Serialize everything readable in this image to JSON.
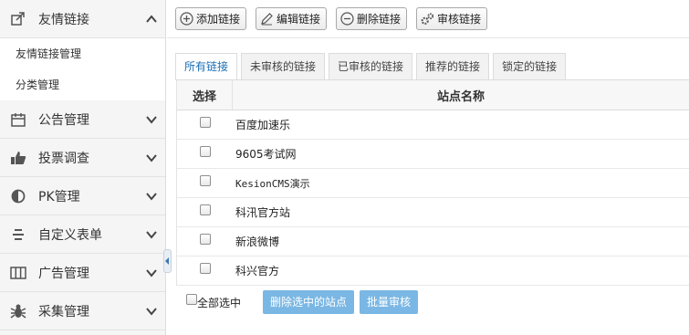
{
  "sidebar": {
    "groups": [
      {
        "label": "友情链接",
        "icon": "link-icon",
        "expanded": true,
        "subitems": [
          "友情链接管理",
          "分类管理"
        ]
      },
      {
        "label": "公告管理",
        "icon": "calendar-icon"
      },
      {
        "label": "投票调查",
        "icon": "thumbs-up-icon"
      },
      {
        "label": "PK管理",
        "icon": "half-circle-icon"
      },
      {
        "label": "自定义表单",
        "icon": "list-icon"
      },
      {
        "label": "广告管理",
        "icon": "columns-icon"
      },
      {
        "label": "采集管理",
        "icon": "bug-icon"
      }
    ]
  },
  "toolbar": {
    "add_label": "添加链接",
    "edit_label": "编辑链接",
    "delete_label": "删除链接",
    "review_label": "审核链接"
  },
  "tabs": [
    {
      "label": "所有链接",
      "active": true
    },
    {
      "label": "未审核的链接"
    },
    {
      "label": "已审核的链接"
    },
    {
      "label": "推荐的链接"
    },
    {
      "label": "锁定的链接"
    }
  ],
  "table": {
    "col_select": "选择",
    "col_name": "站点名称",
    "rows": [
      "百度加速乐",
      "9605考试网",
      "KesionCMS演示",
      "科汛官方站",
      "新浪微博",
      "科兴官方"
    ]
  },
  "bottom": {
    "select_all": "全部选中",
    "delete_selected": "删除选中的站点",
    "batch_review": "批量审核"
  },
  "colors": {
    "accent": "#1a6fb6",
    "button_blue": "#7ab7e4"
  }
}
